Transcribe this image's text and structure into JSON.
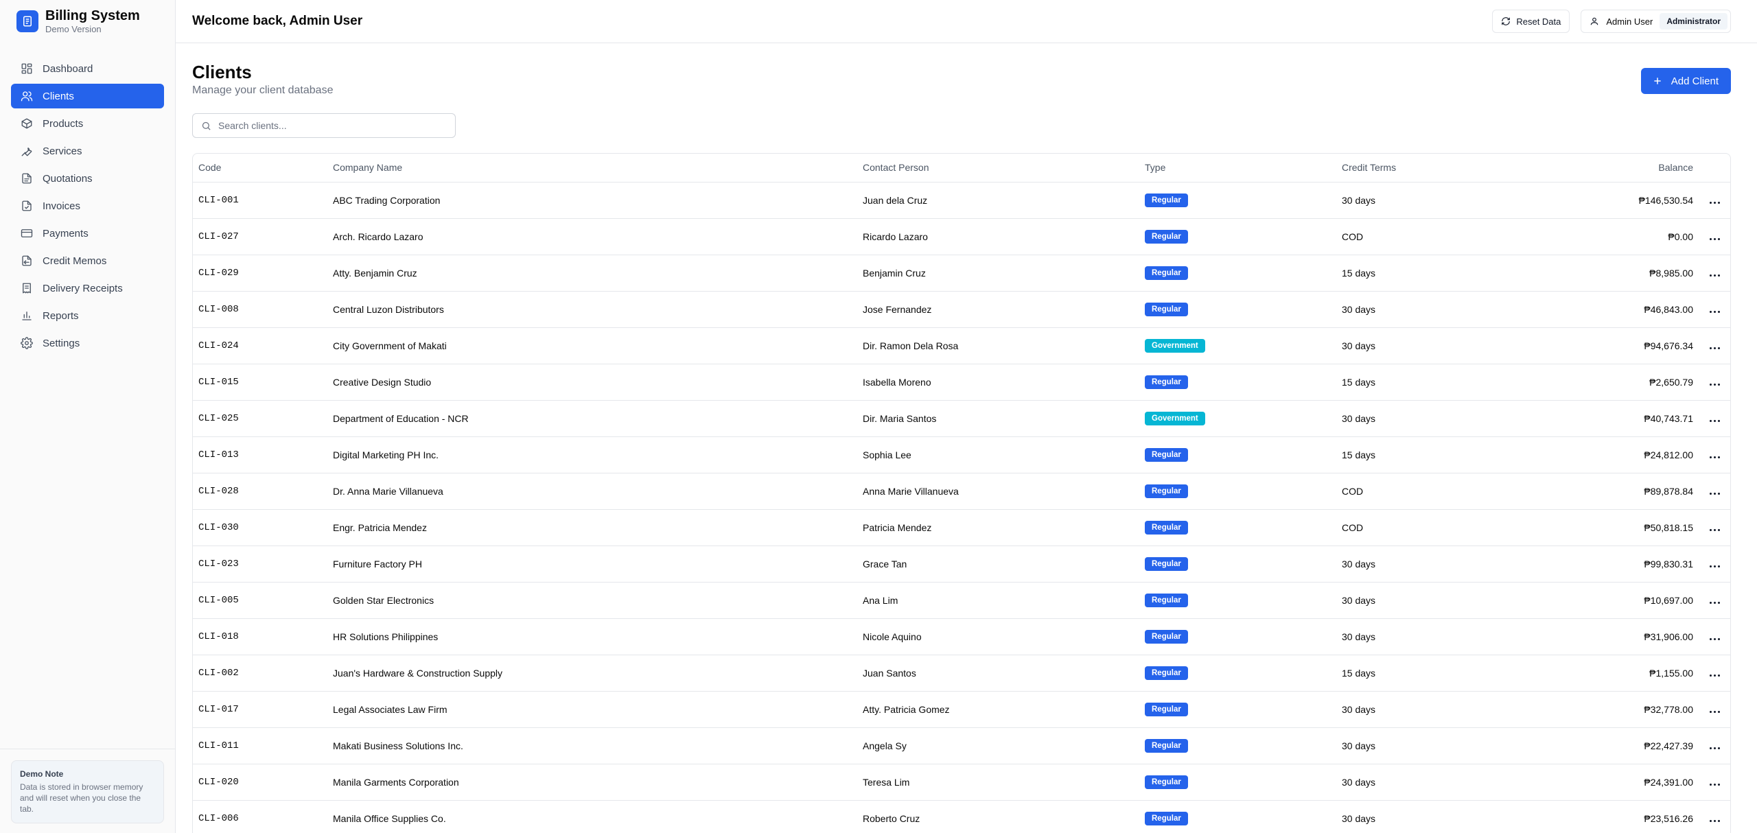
{
  "app": {
    "title": "Billing System",
    "subtitle": "Demo Version"
  },
  "sidebar": {
    "items": [
      {
        "label": "Dashboard",
        "icon": "dashboard-icon"
      },
      {
        "label": "Clients",
        "icon": "users-icon",
        "active": true
      },
      {
        "label": "Products",
        "icon": "box-icon"
      },
      {
        "label": "Services",
        "icon": "wrench-icon"
      },
      {
        "label": "Quotations",
        "icon": "file-icon"
      },
      {
        "label": "Invoices",
        "icon": "file-check-icon"
      },
      {
        "label": "Payments",
        "icon": "credit-card-icon"
      },
      {
        "label": "Credit Memos",
        "icon": "file-arrow-icon"
      },
      {
        "label": "Delivery Receipts",
        "icon": "receipt-icon"
      },
      {
        "label": "Reports",
        "icon": "bar-chart-icon"
      },
      {
        "label": "Settings",
        "icon": "gear-icon"
      }
    ],
    "demo_note": {
      "title": "Demo Note",
      "body": "Data is stored in browser memory and will reset when you close the tab."
    }
  },
  "header": {
    "welcome": "Welcome back, Admin User",
    "reset_label": "Reset Data",
    "user_name": "Admin User",
    "role": "Administrator"
  },
  "page": {
    "title": "Clients",
    "subtitle": "Manage your client database",
    "add_label": "Add Client",
    "search_placeholder": "Search clients..."
  },
  "colors": {
    "primary": "#2563eb",
    "regular": "#2563eb",
    "government": "#06b6d4"
  },
  "table": {
    "columns": [
      "Code",
      "Company Name",
      "Contact Person",
      "Type",
      "Credit Terms",
      "Balance"
    ],
    "rows": [
      {
        "code": "CLI-001",
        "company": "ABC Trading Corporation",
        "contact": "Juan dela Cruz",
        "type": "Regular",
        "terms": "30 days",
        "balance": "₱146,530.54"
      },
      {
        "code": "CLI-027",
        "company": "Arch. Ricardo Lazaro",
        "contact": "Ricardo Lazaro",
        "type": "Regular",
        "terms": "COD",
        "balance": "₱0.00"
      },
      {
        "code": "CLI-029",
        "company": "Atty. Benjamin Cruz",
        "contact": "Benjamin Cruz",
        "type": "Regular",
        "terms": "15 days",
        "balance": "₱8,985.00"
      },
      {
        "code": "CLI-008",
        "company": "Central Luzon Distributors",
        "contact": "Jose Fernandez",
        "type": "Regular",
        "terms": "30 days",
        "balance": "₱46,843.00"
      },
      {
        "code": "CLI-024",
        "company": "City Government of Makati",
        "contact": "Dir. Ramon Dela Rosa",
        "type": "Government",
        "terms": "30 days",
        "balance": "₱94,676.34"
      },
      {
        "code": "CLI-015",
        "company": "Creative Design Studio",
        "contact": "Isabella Moreno",
        "type": "Regular",
        "terms": "15 days",
        "balance": "₱2,650.79"
      },
      {
        "code": "CLI-025",
        "company": "Department of Education - NCR",
        "contact": "Dir. Maria Santos",
        "type": "Government",
        "terms": "30 days",
        "balance": "₱40,743.71"
      },
      {
        "code": "CLI-013",
        "company": "Digital Marketing PH Inc.",
        "contact": "Sophia Lee",
        "type": "Regular",
        "terms": "15 days",
        "balance": "₱24,812.00"
      },
      {
        "code": "CLI-028",
        "company": "Dr. Anna Marie Villanueva",
        "contact": "Anna Marie Villanueva",
        "type": "Regular",
        "terms": "COD",
        "balance": "₱89,878.84"
      },
      {
        "code": "CLI-030",
        "company": "Engr. Patricia Mendez",
        "contact": "Patricia Mendez",
        "type": "Regular",
        "terms": "COD",
        "balance": "₱50,818.15"
      },
      {
        "code": "CLI-023",
        "company": "Furniture Factory PH",
        "contact": "Grace Tan",
        "type": "Regular",
        "terms": "30 days",
        "balance": "₱99,830.31"
      },
      {
        "code": "CLI-005",
        "company": "Golden Star Electronics",
        "contact": "Ana Lim",
        "type": "Regular",
        "terms": "30 days",
        "balance": "₱10,697.00"
      },
      {
        "code": "CLI-018",
        "company": "HR Solutions Philippines",
        "contact": "Nicole Aquino",
        "type": "Regular",
        "terms": "30 days",
        "balance": "₱31,906.00"
      },
      {
        "code": "CLI-002",
        "company": "Juan's Hardware & Construction Supply",
        "contact": "Juan Santos",
        "type": "Regular",
        "terms": "15 days",
        "balance": "₱1,155.00"
      },
      {
        "code": "CLI-017",
        "company": "Legal Associates Law Firm",
        "contact": "Atty. Patricia Gomez",
        "type": "Regular",
        "terms": "30 days",
        "balance": "₱32,778.00"
      },
      {
        "code": "CLI-011",
        "company": "Makati Business Solutions Inc.",
        "contact": "Angela Sy",
        "type": "Regular",
        "terms": "30 days",
        "balance": "₱22,427.39"
      },
      {
        "code": "CLI-020",
        "company": "Manila Garments Corporation",
        "contact": "Teresa Lim",
        "type": "Regular",
        "terms": "30 days",
        "balance": "₱24,391.00"
      },
      {
        "code": "CLI-006",
        "company": "Manila Office Supplies Co.",
        "contact": "Roberto Cruz",
        "type": "Regular",
        "terms": "30 days",
        "balance": "₱23,516.26"
      }
    ]
  }
}
